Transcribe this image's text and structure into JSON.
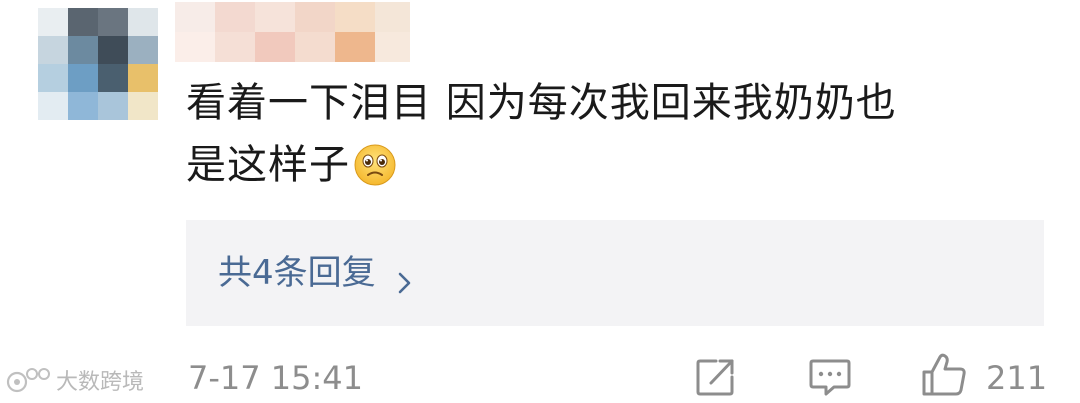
{
  "comment": {
    "text_line1": "看着一下泪目 因为每次我回来我奶奶也",
    "text_line2": "是这样子",
    "emoji": "crying-face-emoji"
  },
  "replies": {
    "label": "共4条回复",
    "chevron": "chevron-right-icon"
  },
  "meta": {
    "timestamp": "7-17 15:41",
    "like_count": "211"
  },
  "watermark": {
    "text": "大数跨境"
  },
  "colors": {
    "link": "#4a6a94",
    "muted": "#8d8d8d",
    "reply_bg": "#f3f3f5",
    "text": "#1a1a1a"
  }
}
